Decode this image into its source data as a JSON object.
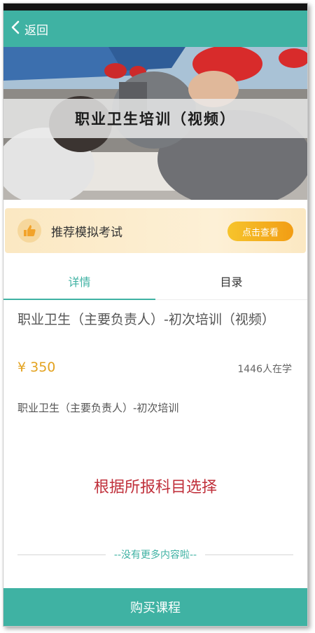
{
  "nav": {
    "back_label": "返回"
  },
  "banner": {
    "title": "职业卫生培训（视频）"
  },
  "promo": {
    "text": "推荐模拟考试",
    "button_label": "点击查看"
  },
  "tabs": [
    {
      "label": "详情",
      "active": true
    },
    {
      "label": "目录",
      "active": false
    }
  ],
  "course": {
    "title": "职业卫生（主要负责人）-初次培训（视频）",
    "price": "¥ 350",
    "learners": "1446人在学",
    "description": "职业卫生（主要负责人）-初次培训"
  },
  "note": "根据所报科目选择",
  "footer": {
    "no_more": "--没有更多内容啦--",
    "buy_label": "购买课程"
  },
  "colors": {
    "brand": "#3fb2a3",
    "price": "#e3a21f",
    "note": "#c0303b",
    "promo_button": "#f4a91f"
  }
}
